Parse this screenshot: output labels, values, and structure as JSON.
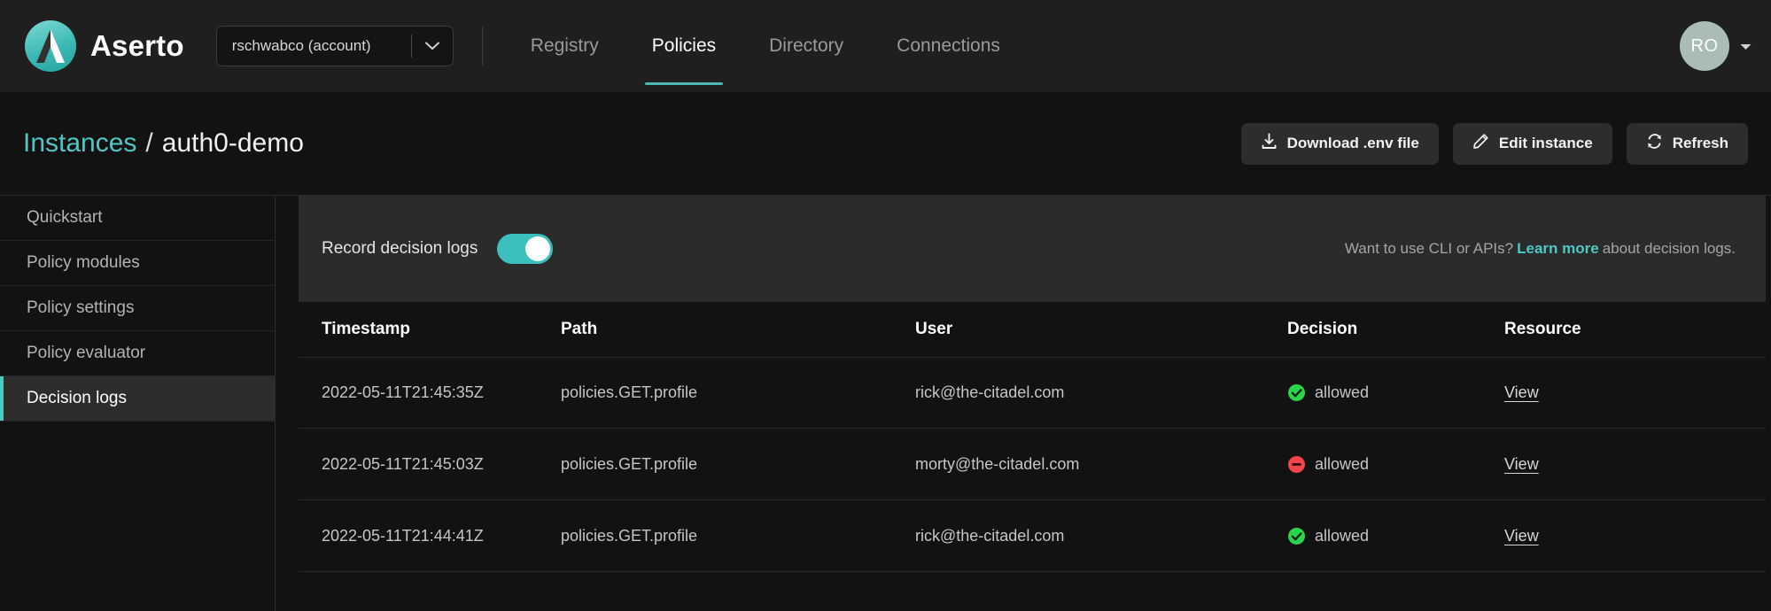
{
  "header": {
    "brand_name": "Aserto",
    "logo_icon": "aserto-logo-icon",
    "account_selector": {
      "value": "rschwabco (account)",
      "caret_icon": "chevron-down-icon"
    },
    "nav_tabs": [
      {
        "label": "Registry",
        "active": false
      },
      {
        "label": "Policies",
        "active": true
      },
      {
        "label": "Directory",
        "active": false
      },
      {
        "label": "Connections",
        "active": false
      }
    ],
    "avatar": {
      "initials": "RO",
      "caret_icon": "caret-down-icon",
      "color": "#a9bcb5"
    }
  },
  "subheader": {
    "breadcrumb": {
      "parent": "Instances",
      "separator": "/",
      "current": "auth0-demo"
    },
    "actions": [
      {
        "label": "Download .env file",
        "icon": "download-icon"
      },
      {
        "label": "Edit instance",
        "icon": "pencil-icon"
      },
      {
        "label": "Refresh",
        "icon": "refresh-icon"
      }
    ]
  },
  "sidebar": {
    "items": [
      {
        "label": "Quickstart",
        "active": false
      },
      {
        "label": "Policy modules",
        "active": false
      },
      {
        "label": "Policy settings",
        "active": false
      },
      {
        "label": "Policy evaluator",
        "active": false
      },
      {
        "label": "Decision logs",
        "active": true
      }
    ]
  },
  "toggle_panel": {
    "label": "Record decision logs",
    "enabled": true,
    "hint_prefix": "Want to use CLI or APIs?",
    "hint_link": "Learn more",
    "hint_suffix": "about decision logs."
  },
  "table": {
    "columns": [
      "Timestamp",
      "Path",
      "User",
      "Decision",
      "Resource"
    ],
    "rows": [
      {
        "timestamp": "2022-05-11T21:45:35Z",
        "path": "policies.GET.profile",
        "user": "rick@the-citadel.com",
        "decision": "allowed",
        "decision_icon": "check-circle-icon",
        "decision_color": "#2bd44a",
        "resource": "View"
      },
      {
        "timestamp": "2022-05-11T21:45:03Z",
        "path": "policies.GET.profile",
        "user": "morty@the-citadel.com",
        "decision": "allowed",
        "decision_icon": "minus-circle-icon",
        "decision_color": "#f4434a",
        "resource": "View"
      },
      {
        "timestamp": "2022-05-11T21:44:41Z",
        "path": "policies.GET.profile",
        "user": "rick@the-citadel.com",
        "decision": "allowed",
        "decision_icon": "check-circle-icon",
        "decision_color": "#2bd44a",
        "resource": "View"
      }
    ]
  },
  "theme": {
    "accent": "#4ec8c4",
    "toggle_on": "#3cbfbd",
    "bg": "#121212",
    "panel": "#2b2b2b"
  }
}
